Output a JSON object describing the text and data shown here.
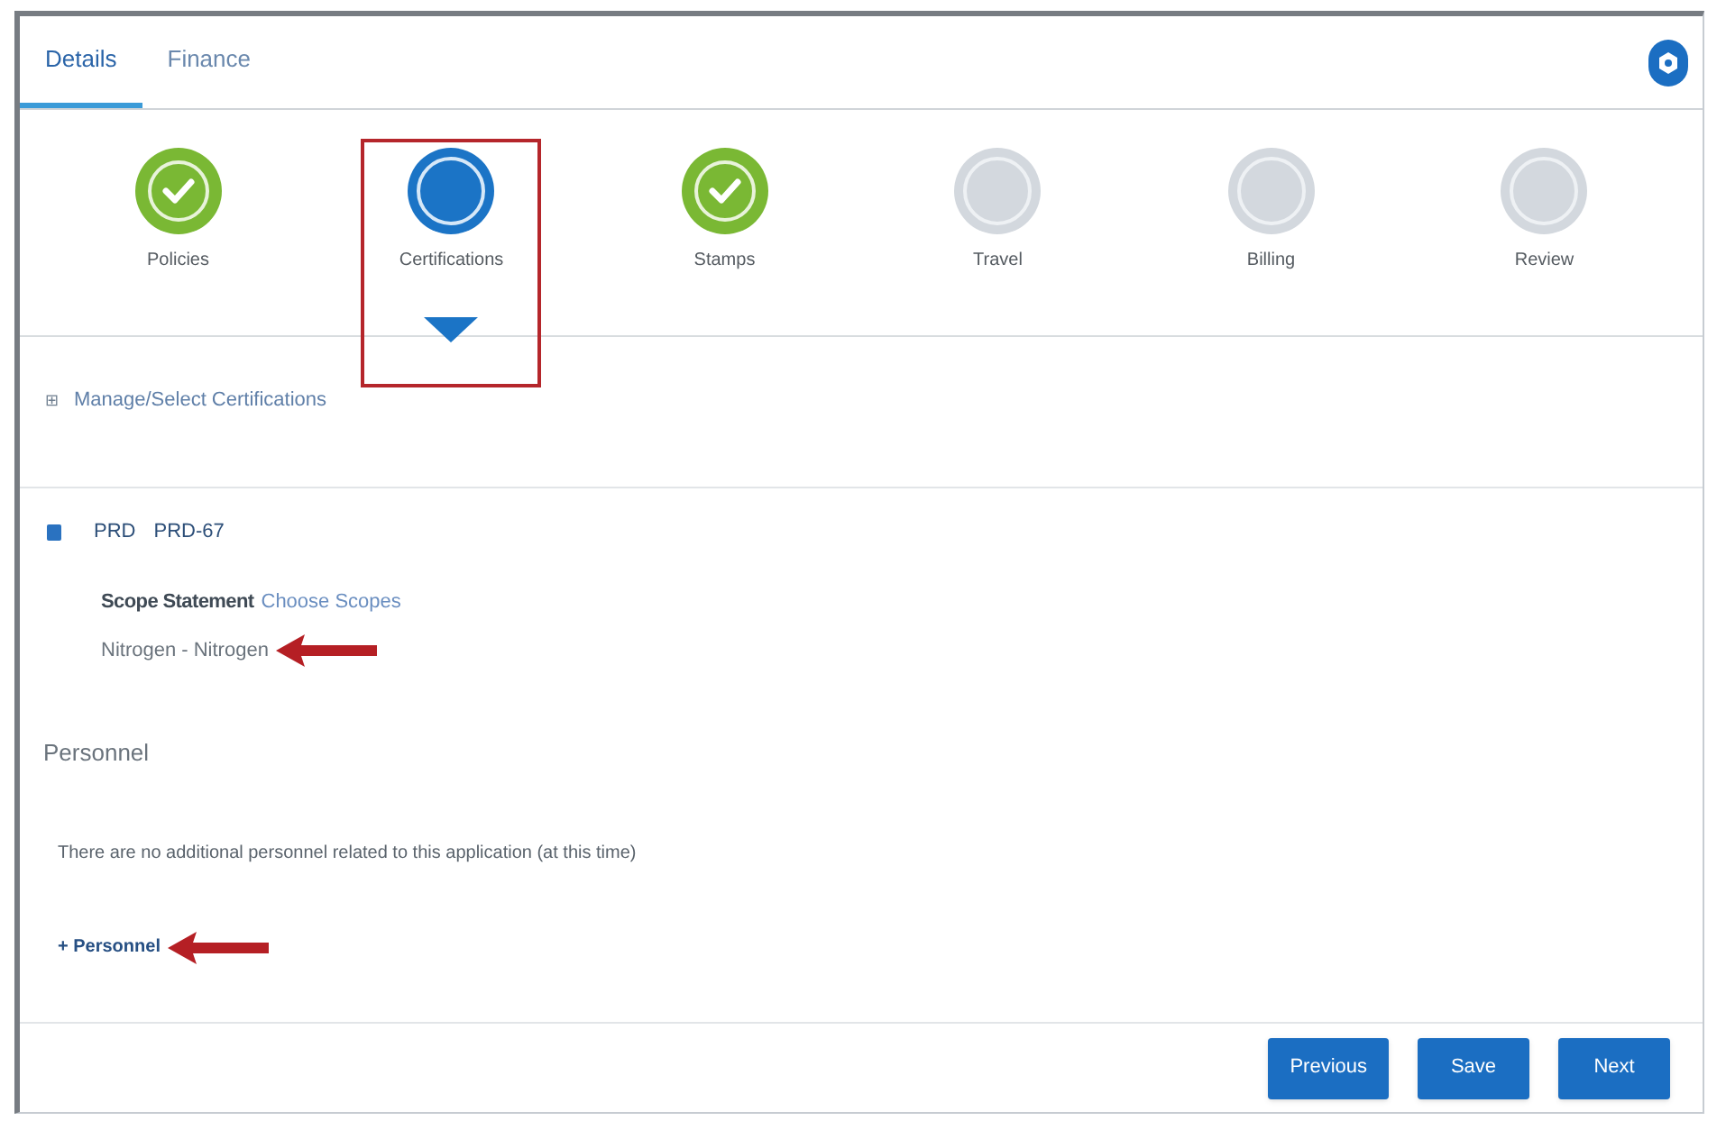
{
  "tabs": [
    {
      "label": "Details",
      "selected": true
    },
    {
      "label": "Finance",
      "selected": false
    }
  ],
  "steps": [
    {
      "label": "Policies",
      "kind": "complete",
      "highlighted": false
    },
    {
      "label": "Certifications",
      "kind": "current",
      "highlighted": true
    },
    {
      "label": "Stamps",
      "kind": "complete",
      "highlighted": false
    },
    {
      "label": "Travel",
      "kind": "pending",
      "highlighted": false
    },
    {
      "label": "Billing",
      "kind": "pending",
      "highlighted": false
    },
    {
      "label": "Review",
      "kind": "pending",
      "highlighted": false
    }
  ],
  "manage_link": {
    "icon": "⊞",
    "label": "Manage/Select Certifications"
  },
  "certification": {
    "checked": true,
    "code": "PRD",
    "id": "PRD-67",
    "scope_label": "Scope Statement",
    "scope_link": "Choose Scopes",
    "scope_value": "Nitrogen - Nitrogen",
    "annotated": true
  },
  "personnel": {
    "heading": "Personnel",
    "message": "There are no additional personnel related to this application (at this time)",
    "add_link": "+ Personnel",
    "annotated": true
  },
  "buttons": [
    "Previous",
    "Save",
    "Next"
  ]
}
